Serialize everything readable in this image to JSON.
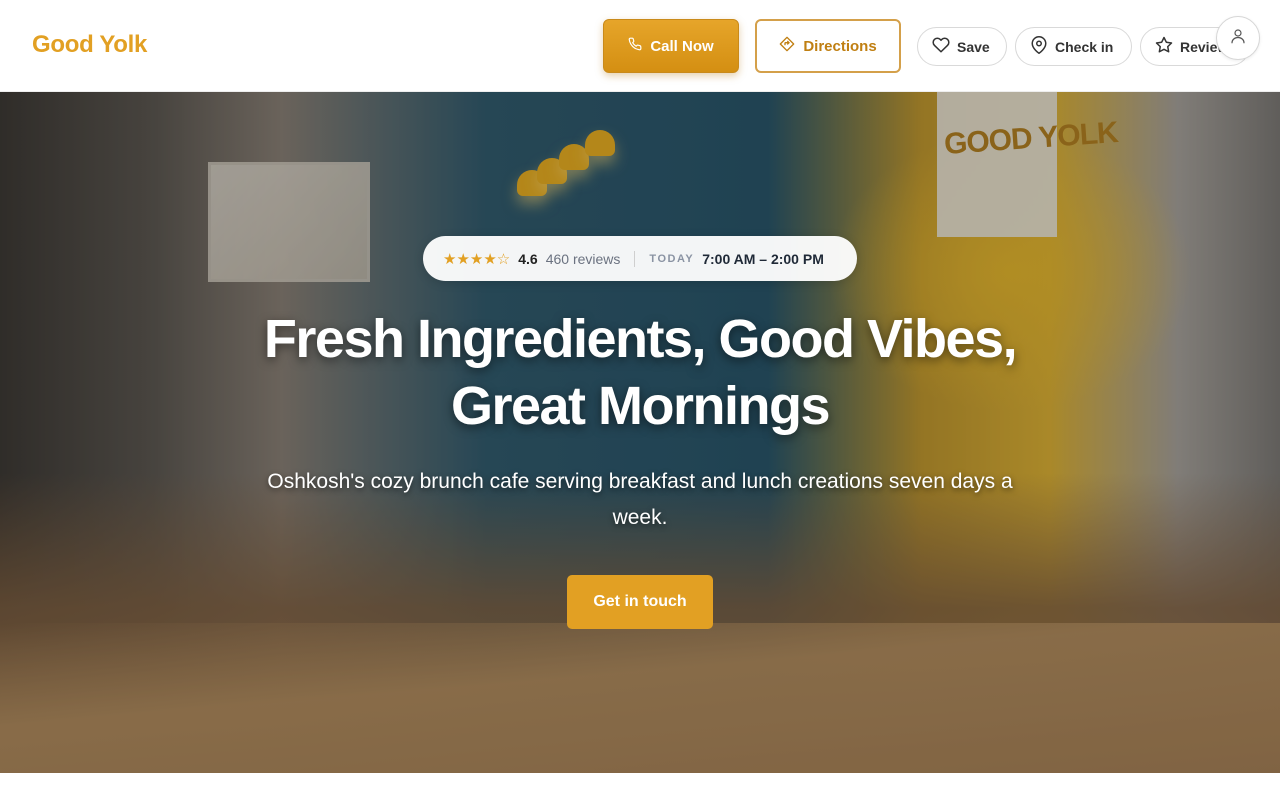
{
  "brand": {
    "name": "Good Yolk"
  },
  "header": {
    "call_label": "Call Now",
    "directions_label": "Directions",
    "save_label": "Save",
    "checkin_label": "Check in",
    "review_label": "Review"
  },
  "hero": {
    "rating": "4.6",
    "rating_stars": 4.5,
    "stars_glyphs": "★★★★☆",
    "reviews_label": "460 reviews",
    "today_label": "TODAY",
    "hours": "7:00 AM – 2:00 PM",
    "headline_line1": "Fresh Ingredients, Good Vibes,",
    "headline_line2": "Great Mornings",
    "subtitle": "Oshkosh's cozy brunch cafe serving breakfast and lunch creations seven days a week.",
    "cta_label": "Get in touch",
    "sign_text": "GOOD YOLK"
  },
  "colors": {
    "accent": "#e2a023",
    "accent_dark": "#c07f12",
    "text_dark": "#1f2937",
    "muted": "#6b7280"
  },
  "icons": {
    "call": "phone-icon",
    "directions": "directions-icon",
    "save": "heart-icon",
    "checkin": "map-pin-icon",
    "review": "star-icon",
    "account": "user-icon"
  }
}
